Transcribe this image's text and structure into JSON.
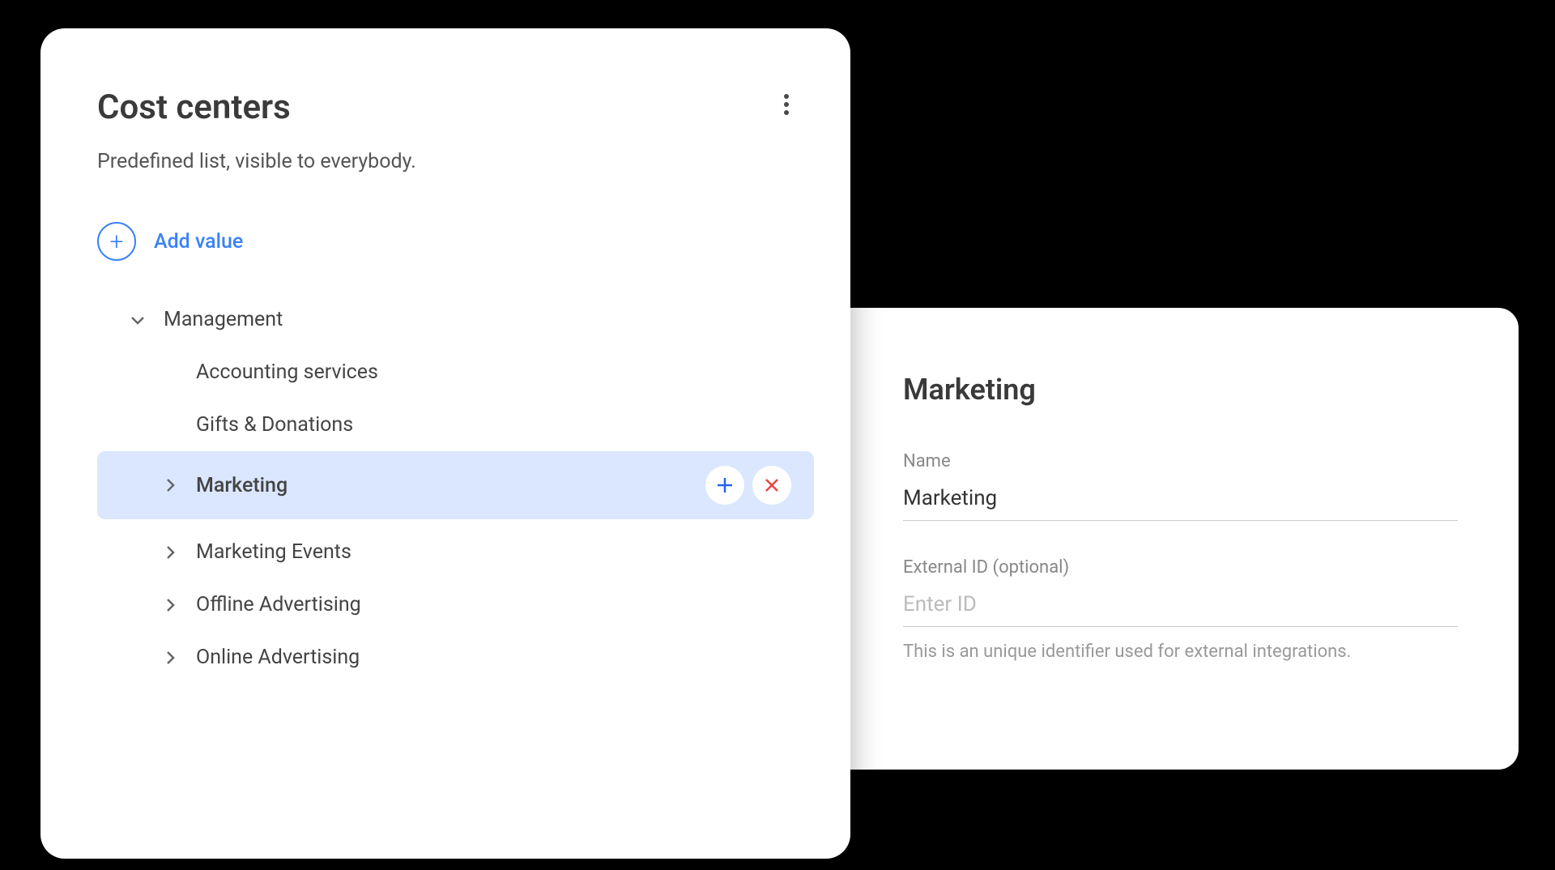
{
  "leftPanel": {
    "title": "Cost centers",
    "subtitle": "Predefined list, visible to everybody.",
    "addValueLabel": "Add value",
    "tree": {
      "root": {
        "label": "Management",
        "expanded": true
      },
      "children": [
        {
          "label": "Accounting services",
          "hasChildren": false
        },
        {
          "label": "Gifts & Donations",
          "hasChildren": false
        },
        {
          "label": "Marketing",
          "hasChildren": true,
          "selected": true
        },
        {
          "label": "Marketing Events",
          "hasChildren": true
        },
        {
          "label": "Offline Advertising",
          "hasChildren": true
        },
        {
          "label": "Online Advertising",
          "hasChildren": true
        }
      ]
    }
  },
  "rightPanel": {
    "title": "Marketing",
    "nameField": {
      "label": "Name",
      "value": "Marketing"
    },
    "externalIdField": {
      "label": "External ID (optional)",
      "placeholder": "Enter ID",
      "helper": "This is an unique identifier used for external integrations."
    }
  }
}
